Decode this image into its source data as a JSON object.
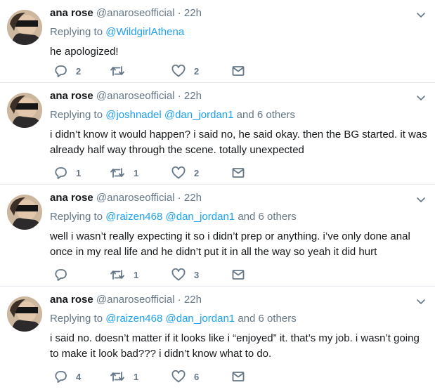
{
  "tweets": [
    {
      "name": "ana rose",
      "handle": "@anaroseofficial",
      "sep": "·",
      "time": "22h",
      "replying_label": "Replying to",
      "mentions": [
        "@WildgirlAthena"
      ],
      "others": "",
      "text": "he apologized!",
      "reply_count": "2",
      "retweet_count": "",
      "like_count": "2"
    },
    {
      "name": "ana rose",
      "handle": "@anaroseofficial",
      "sep": "·",
      "time": "22h",
      "replying_label": "Replying to",
      "mentions": [
        "@joshnadel",
        "@dan_jordan1"
      ],
      "others": "and 6 others",
      "text": "i didn’t know it would happen? i said no, he said okay. then the BG started. it was already half way through the scene. totally unexpected",
      "reply_count": "1",
      "retweet_count": "1",
      "like_count": "2"
    },
    {
      "name": "ana rose",
      "handle": "@anaroseofficial",
      "sep": "·",
      "time": "22h",
      "replying_label": "Replying to",
      "mentions": [
        "@raizen468",
        "@dan_jordan1"
      ],
      "others": "and 6 others",
      "text": "well i wasn’t really expecting it so i didn’t prep or anything. i’ve only done anal once in my real life and he didn’t put it in all the way so yeah it did hurt",
      "reply_count": "",
      "retweet_count": "1",
      "like_count": "3"
    },
    {
      "name": "ana rose",
      "handle": "@anaroseofficial",
      "sep": "·",
      "time": "22h",
      "replying_label": "Replying to",
      "mentions": [
        "@raizen468",
        "@dan_jordan1"
      ],
      "others": "and 6 others",
      "text": "i said no. doesn’t matter if it looks like i “enjoyed” it. that’s my job. i wasn’t going to make it look bad??? i didn’t know what to do.",
      "reply_count": "4",
      "retweet_count": "1",
      "like_count": "6"
    }
  ],
  "colors": {
    "link": "#1da1f2",
    "muted": "#657786",
    "text": "#14171a",
    "divider": "#e6ecf0"
  },
  "icons": {
    "reply": "reply-icon",
    "retweet": "retweet-icon",
    "like": "heart-icon",
    "dm": "envelope-icon",
    "menu": "chevron-down-icon"
  }
}
